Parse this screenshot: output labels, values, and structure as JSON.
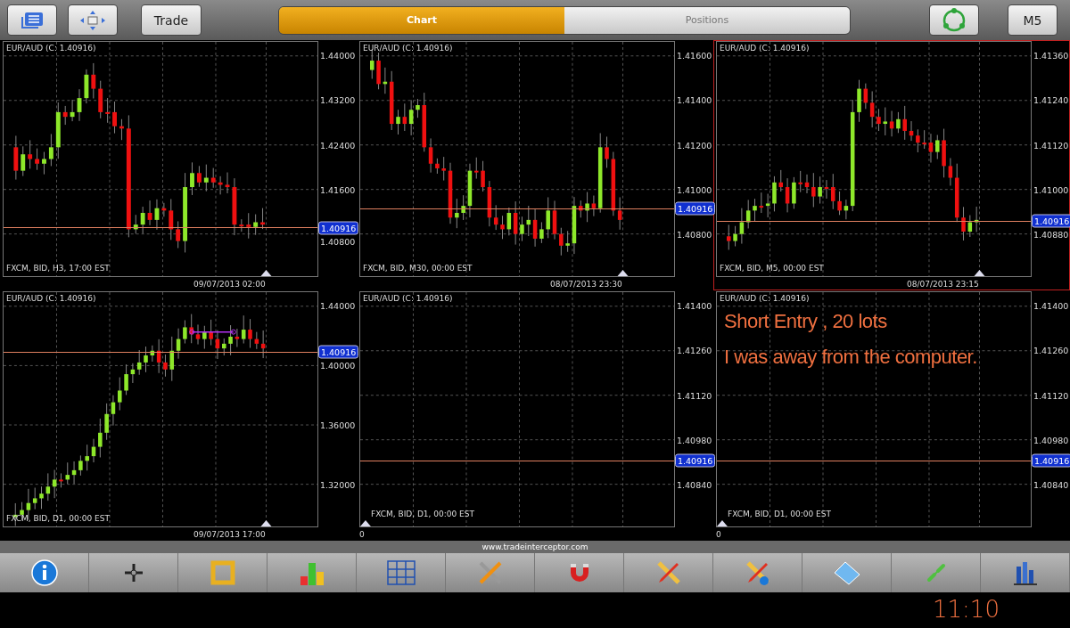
{
  "top_bar": {
    "trade_button": "Trade",
    "tabs": [
      {
        "label": "Chart",
        "selected": true
      },
      {
        "label": "Positions",
        "selected": false
      }
    ],
    "timeframe_button": "M5"
  },
  "panels": [
    {
      "kind": "candles",
      "selected": false,
      "title": "EUR/AUD (C: 1.40916)",
      "footer": "FXCM, BID, H3, 17:00 EST",
      "date": "09/07/2013 02:00",
      "yticks": [
        "1.44000",
        "1.43200",
        "1.42400",
        "1.41600",
        "1.40800"
      ],
      "price": "1.40916"
    },
    {
      "kind": "candles",
      "selected": false,
      "title": "EUR/AUD (C: 1.40916)",
      "footer": "FXCM, BID, M30, 00:00 EST",
      "date": "08/07/2013 23:30",
      "yticks": [
        "1.41600",
        "1.41400",
        "1.41200",
        "1.41000",
        "1.40800"
      ],
      "price": "1.40916"
    },
    {
      "kind": "candles",
      "selected": true,
      "title": "EUR/AUD (C: 1.40916)",
      "footer": "FXCM, BID, M5, 00:00 EST",
      "date": "08/07/2013 23:15",
      "yticks": [
        "1.41360",
        "1.41240",
        "1.41120",
        "1.41000",
        "1.40880"
      ],
      "price": "1.40916"
    },
    {
      "kind": "candles",
      "selected": false,
      "title": "EUR/AUD (C: 1.40916)",
      "footer": "FXCM, BID, D1, 00:00 EST",
      "date": "09/07/2013 17:00",
      "yticks": [
        "1.44000",
        "1.40000",
        "1.36000",
        "1.32000"
      ],
      "price": "1.40916"
    },
    {
      "kind": "empty",
      "selected": false,
      "title": "EUR/AUD (C: 1.40916)",
      "footer": "FXCM, BID, D1, 00:00 EST",
      "date": "0",
      "yticks": [
        "1.41400",
        "1.41260",
        "1.41120",
        "1.40980",
        "1.40840"
      ],
      "price": "1.40916"
    },
    {
      "kind": "empty",
      "selected": false,
      "title": "EUR/AUD (C: 1.40916)",
      "footer": "FXCM, BID, D1, 00:00 EST",
      "date": "0",
      "yticks": [
        "1.41400",
        "1.41260",
        "1.41120",
        "1.40980",
        "1.40840"
      ],
      "price": "1.40916",
      "notes": [
        "Short Entry , 20 lots",
        "I was away from the computer."
      ]
    }
  ],
  "website": "www.tradeinterceptor.com",
  "bottom_note": "11:10"
}
